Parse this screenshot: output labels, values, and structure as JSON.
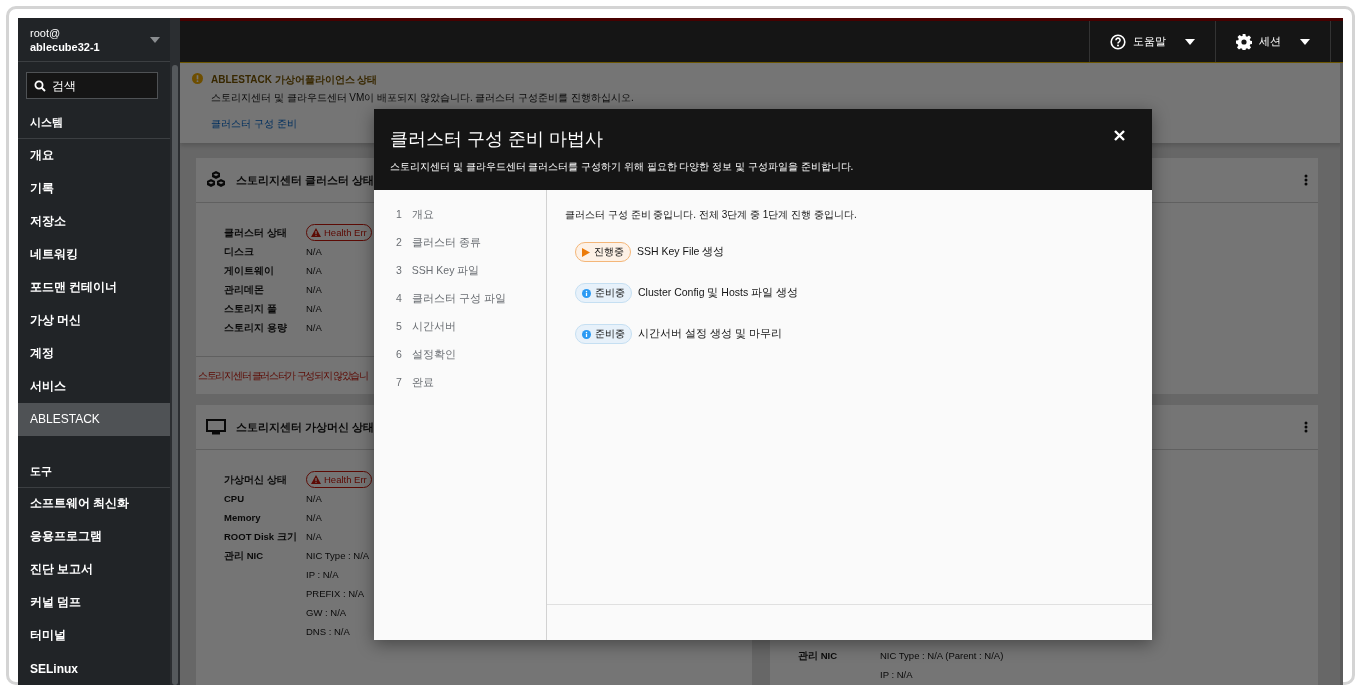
{
  "sidebar": {
    "user": "root@",
    "host": "ablecube32-1",
    "search": {
      "placeholder": "검색"
    },
    "sections": [
      {
        "heading": "시스템",
        "items": [
          {
            "label": "개요",
            "selected": false
          },
          {
            "label": "기록",
            "selected": false
          },
          {
            "label": "저장소",
            "selected": false
          },
          {
            "label": "네트워킹",
            "selected": false
          },
          {
            "label": "포드맨 컨테이너",
            "selected": false
          },
          {
            "label": "가상 머신",
            "selected": false
          },
          {
            "label": "계정",
            "selected": false
          },
          {
            "label": "서비스",
            "selected": false
          },
          {
            "label": "ABLESTACK",
            "selected": true
          }
        ]
      },
      {
        "heading": "도구",
        "items": [
          {
            "label": "소프트웨어 최신화",
            "selected": false
          },
          {
            "label": "응용프로그램",
            "selected": false
          },
          {
            "label": "진단 보고서",
            "selected": false
          },
          {
            "label": "커널 덤프",
            "selected": false
          },
          {
            "label": "터미널",
            "selected": false
          },
          {
            "label": "SELinux",
            "selected": false
          }
        ]
      }
    ]
  },
  "topbar": {
    "buttons": [
      {
        "kind": "help",
        "label": "도움말"
      },
      {
        "kind": "session",
        "label": "세션"
      }
    ]
  },
  "alert": {
    "title": "ABLESTACK 가상어플라이언스 상태",
    "message": "스토리지센터 및 클라우드센터 VM이 배포되지 않았습니다. 클러스터 구성준비를 진행하십시오.",
    "link": "클러스터 구성 준비"
  },
  "cards": [
    {
      "kind": "cluster",
      "title": "스토리지센터 클러스터 상태",
      "menu": false,
      "rows": [
        {
          "label": "클러스터 상태",
          "badge": "Health Err"
        },
        {
          "label": "디스크",
          "values": [
            "N/A"
          ]
        },
        {
          "label": "게이트웨이",
          "values": [
            "N/A"
          ]
        },
        {
          "label": "관리데몬",
          "values": [
            "N/A"
          ]
        },
        {
          "label": "스토리지 풀",
          "values": [
            "N/A"
          ]
        },
        {
          "label": "스토리지 용량",
          "values": [
            "N/A"
          ]
        }
      ],
      "footer": "스토리지센터 클러스터가 구성되지 않았습니"
    },
    {
      "kind": "blank",
      "menu": true
    },
    {
      "kind": "vm",
      "title": "스토리지센터 가상머신 상태",
      "menu": false,
      "rows": [
        {
          "label": "가상머신 상태",
          "badge": "Health Err"
        },
        {
          "label": "CPU",
          "values": [
            "N/A"
          ]
        },
        {
          "label": "Memory",
          "values": [
            "N/A"
          ]
        },
        {
          "label": "ROOT Disk 크기",
          "values": [
            "N/A"
          ]
        },
        {
          "label": "관리 NIC",
          "values": [
            "NIC Type : N/A",
            "IP : N/A",
            "PREFIX : N/A",
            "GW : N/A",
            "DNS : N/A"
          ]
        }
      ]
    },
    {
      "kind": "detail",
      "menu": true,
      "rows": [
        {
          "label": "관리 NIC",
          "values": [
            "NIC Type : N/A (Parent : N/A)",
            "IP : N/A"
          ]
        }
      ]
    }
  ],
  "modal": {
    "title": "클러스터 구성 준비 마법사",
    "subtitle": "스토리지센터 및 클라우드센터 클러스터를 구성하기 위해 필요한 다양한 정보 및 구성파일을 준비합니다.",
    "steps": [
      {
        "number": "1",
        "label": "개요"
      },
      {
        "number": "2",
        "label": "클러스터 종류"
      },
      {
        "number": "3",
        "label": "SSH Key 파일"
      },
      {
        "number": "4",
        "label": "클러스터 구성 파일"
      },
      {
        "number": "5",
        "label": "시간서버"
      },
      {
        "number": "6",
        "label": "설정확인"
      },
      {
        "number": "7",
        "label": "완료"
      }
    ],
    "intro": "클러스터 구성 준비 중입니다. 전체 3단계 중 1단계 진행 중입니다.",
    "tasks": [
      {
        "kind": "running",
        "badge": "진행중",
        "label": "SSH Key File 생성"
      },
      {
        "kind": "pending",
        "badge": "준비중",
        "label": "Cluster Config 및 Hosts 파일 생성"
      },
      {
        "kind": "pending",
        "badge": "준비중",
        "label": "시간서버 설정 생성 및 마무리"
      }
    ]
  }
}
